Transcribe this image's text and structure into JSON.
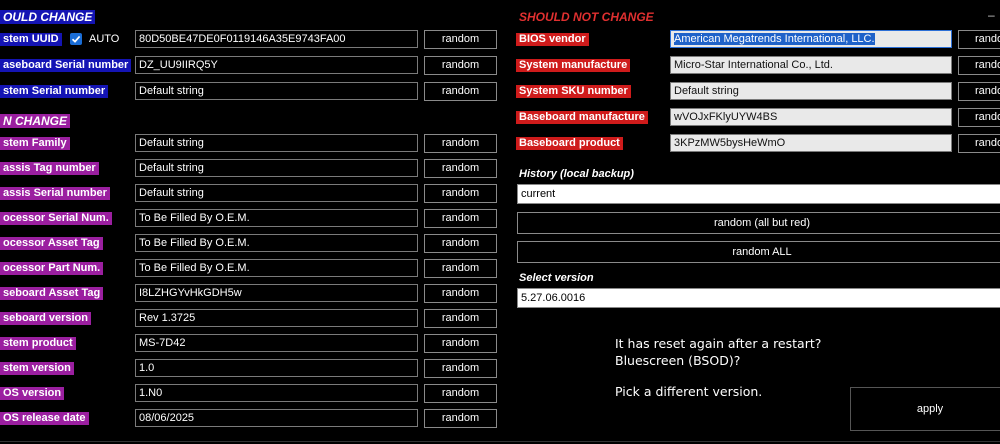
{
  "left": {
    "should_change": {
      "title": "OULD CHANGE",
      "uuid": {
        "label": "stem UUID",
        "value": "80D50BE47DE0F0119146A35E9743FA00",
        "auto_label": "AUTO"
      },
      "baseboard_serial": {
        "label": "aseboard Serial number",
        "value": "DZ_UU9IIRQ5Y"
      },
      "system_serial": {
        "label": "stem Serial number",
        "value": "Default string"
      }
    },
    "can_change": {
      "title": "N CHANGE",
      "rows": [
        {
          "label": "stem Family",
          "value": "Default string"
        },
        {
          "label": "assis Tag number",
          "value": "Default string"
        },
        {
          "label": "assis Serial number",
          "value": "Default string"
        },
        {
          "label": "ocessor Serial Num.",
          "value": "To Be Filled By O.E.M."
        },
        {
          "label": "ocessor Asset Tag",
          "value": "To Be Filled By O.E.M."
        },
        {
          "label": "ocessor Part Num.",
          "value": "To Be Filled By O.E.M."
        },
        {
          "label": "seboard Asset Tag",
          "value": "I8LZHGYvHkGDH5w"
        },
        {
          "label": "seboard version",
          "value": "Rev 1.3725"
        },
        {
          "label": "stem product",
          "value": "MS-7D42"
        },
        {
          "label": "stem version",
          "value": "1.0"
        },
        {
          "label": "OS version",
          "value": "1.N0"
        },
        {
          "label": "OS release date",
          "value": "08/06/2025"
        }
      ]
    },
    "random_label": "random"
  },
  "right": {
    "title": "SHOULD NOT CHANGE",
    "minimize": "–",
    "rows": [
      {
        "label": "BIOS vendor",
        "value": "American Megatrends International, LLC."
      },
      {
        "label": "System manufacture",
        "value": "Micro-Star International Co., Ltd."
      },
      {
        "label": "System SKU number",
        "value": "Default string"
      },
      {
        "label": "Baseboard manufacture",
        "value": "wVOJxFKlyUYW4BS"
      },
      {
        "label": "Baseboard product",
        "value": "3KPzMW5bysHeWmO"
      }
    ],
    "random_label": "rando",
    "history_label": "History (local backup)",
    "history_value": "current",
    "random_all_but_red": "random (all but red)",
    "random_all": "random ALL",
    "select_version_label": "Select version",
    "version_value": "5.27.06.0016",
    "message": {
      "line1": "It has reset again after a restart?",
      "line2": "Bluescreen (BSOD)?",
      "line3": "Pick a different version."
    },
    "apply_label": "apply"
  },
  "colors": {
    "blue": "#1414b4",
    "purple": "#9b1fa0",
    "red": "#cf1b1b",
    "head_red": "#e03030"
  }
}
